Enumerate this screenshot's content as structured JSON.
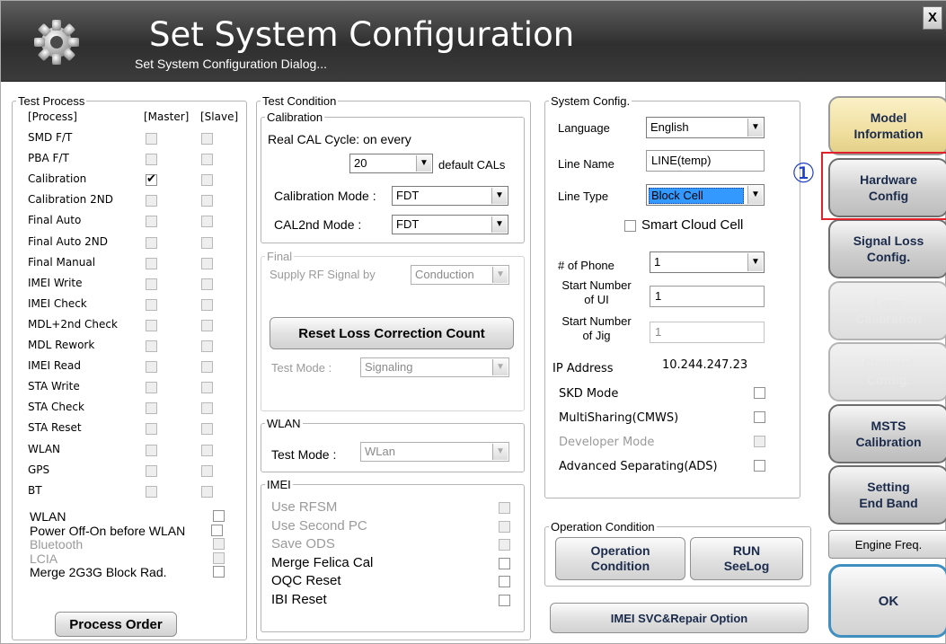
{
  "window": {
    "title": "Set System Configuration",
    "subtitle": "Set System Configuration Dialog...",
    "close_label": "X"
  },
  "test_process": {
    "legend": "Test Process",
    "col_process": "[Process]",
    "col_master": "[Master]",
    "col_slave": "[Slave]",
    "rows": [
      {
        "label": "SMD F/T",
        "master": false,
        "slave": false
      },
      {
        "label": "PBA F/T",
        "master": false,
        "slave": false
      },
      {
        "label": "Calibration",
        "master": true,
        "slave": false
      },
      {
        "label": "Calibration 2ND",
        "master": false,
        "slave": false
      },
      {
        "label": "Final Auto",
        "master": false,
        "slave": false
      },
      {
        "label": "Final Auto 2ND",
        "master": false,
        "slave": false
      },
      {
        "label": "Final Manual",
        "master": false,
        "slave": false
      },
      {
        "label": "IMEI Write",
        "master": false,
        "slave": false
      },
      {
        "label": "IMEI Check",
        "master": false,
        "slave": false
      },
      {
        "label": "MDL+2nd Check",
        "master": false,
        "slave": false
      },
      {
        "label": "MDL Rework",
        "master": false,
        "slave": false
      },
      {
        "label": "IMEI Read",
        "master": false,
        "slave": false
      },
      {
        "label": "STA Write",
        "master": false,
        "slave": false
      },
      {
        "label": "STA Check",
        "master": false,
        "slave": false
      },
      {
        "label": "STA Reset",
        "master": false,
        "slave": false
      },
      {
        "label": "WLAN",
        "master": false,
        "slave": false
      },
      {
        "label": "GPS",
        "master": false,
        "slave": false
      },
      {
        "label": "BT",
        "master": false,
        "slave": false
      }
    ],
    "options": [
      {
        "label": "WLAN",
        "enabled": true
      },
      {
        "label": "Power Off-On before WLAN",
        "enabled": true
      },
      {
        "label": "Bluetooth",
        "enabled": false
      },
      {
        "label": "LCIA",
        "enabled": false
      },
      {
        "label": "Merge 2G3G Block Rad.",
        "enabled": true
      }
    ],
    "process_order_label": "Process Order"
  },
  "test_condition": {
    "legend": "Test Condition",
    "calibration": {
      "legend": "Calibration",
      "cycle_text": "Real CAL Cycle: on every",
      "cycle_value": "20",
      "cycle_suffix": "default CALs",
      "mode_label": "Calibration Mode :",
      "mode_value": "FDT",
      "cal2nd_label": "CAL2nd Mode :",
      "cal2nd_value": "FDT"
    },
    "final": {
      "legend": "Final",
      "supply_label": "Supply RF Signal by",
      "supply_value": "Conduction",
      "reset_label": "Reset Loss Correction Count",
      "test_mode_label": "Test Mode :",
      "test_mode_value": "Signaling"
    },
    "wlan": {
      "legend": "WLAN",
      "test_mode_label": "Test Mode :",
      "test_mode_value": "WLan"
    },
    "imei": {
      "legend": "IMEI",
      "options": [
        {
          "label": "Use RFSM",
          "enabled": false
        },
        {
          "label": "Use Second PC",
          "enabled": false
        },
        {
          "label": "Save ODS",
          "enabled": false
        },
        {
          "label": "Merge Felica Cal",
          "enabled": true
        },
        {
          "label": "OQC Reset",
          "enabled": true
        },
        {
          "label": "IBI Reset",
          "enabled": true
        }
      ]
    }
  },
  "system_config": {
    "legend": "System Config.",
    "language_label": "Language",
    "language_value": "English",
    "line_name_label": "Line Name",
    "line_name_value": "LINE(temp)",
    "line_type_label": "Line Type",
    "line_type_value": "Block Cell",
    "smart_cloud_label": "Smart Cloud Cell",
    "phone_label": "# of Phone",
    "phone_value": "1",
    "start_ui_label_1": "Start Number",
    "start_ui_label_2": "of UI",
    "start_ui_value": "1",
    "start_jig_label_1": "Start Number",
    "start_jig_label_2": "of Jig",
    "start_jig_value": "1",
    "ip_label": "IP Address",
    "ip_value": "10.244.247.23",
    "flags": [
      {
        "label": "SKD Mode",
        "enabled": true
      },
      {
        "label": "MultiSharing(CMWS)",
        "enabled": true
      },
      {
        "label": "Developer Mode",
        "enabled": false
      },
      {
        "label": "Advanced Separating(ADS)",
        "enabled": true
      }
    ]
  },
  "operation_condition": {
    "legend": "Operation Condition",
    "operation_button": "Operation\nCondition",
    "run_button": "RUN\nSeeLog"
  },
  "imei_svc_label": "IMEI SVC&Repair Option",
  "right_buttons": [
    {
      "label": "Model\nInformation",
      "enabled": true
    },
    {
      "label": "Hardware\nConfig",
      "enabled": true
    },
    {
      "label": "Signal Loss\nConfig.",
      "enabled": true
    },
    {
      "label": "Loss\nCalibration",
      "enabled": false
    },
    {
      "label": "Channel\nConfig.",
      "enabled": false
    },
    {
      "label": "MSTS\nCalibration",
      "enabled": true
    },
    {
      "label": "Setting\nEnd Band",
      "enabled": true
    }
  ],
  "engine_freq_label": "Engine Freq.",
  "ok_label": "OK",
  "annotation": {
    "marker": "①",
    "highlight_color": "#e0202a"
  },
  "colors": {
    "model_button": "#f0dfa0",
    "ok_border": "#3f8fc0",
    "selected_bg": "#3399ff"
  }
}
